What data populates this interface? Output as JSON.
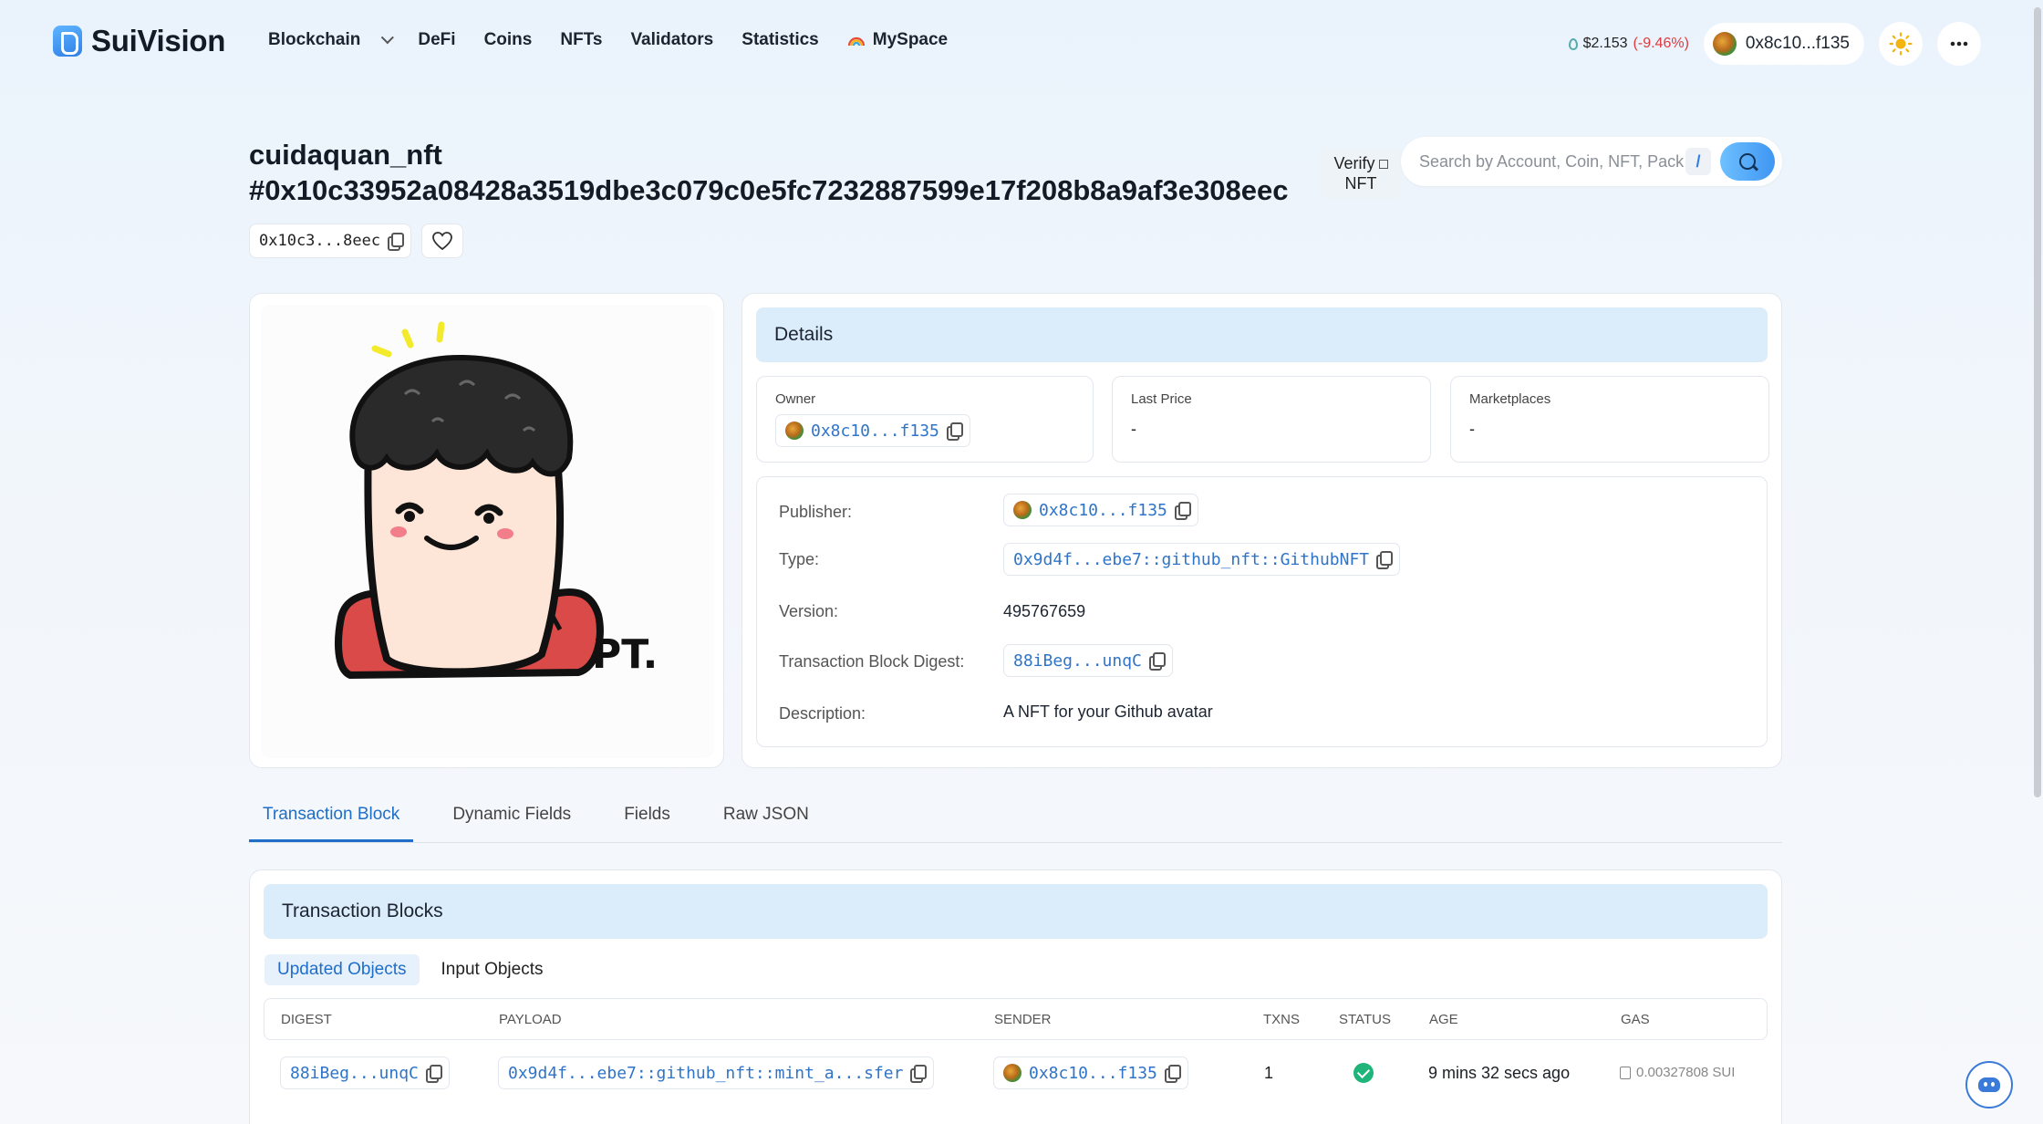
{
  "header": {
    "brand": "SuiVision",
    "nav": [
      {
        "label": "Blockchain"
      },
      {
        "label": "DeFi"
      },
      {
        "label": "Coins"
      },
      {
        "label": "NFTs"
      },
      {
        "label": "Validators"
      },
      {
        "label": "Statistics"
      },
      {
        "label": "MySpace"
      }
    ],
    "price": "$2.153",
    "price_change": "(-9.46%)",
    "wallet": "0x8c10...f135"
  },
  "nft": {
    "title_line1": "cuidaquan_nft",
    "title_line2": "#0x10c33952a08428a3519dbe3c079c0e5fc7232887599e17f208b8a9af3e308eec",
    "short_id": "0x10c3...8eec",
    "image_text": "PT."
  },
  "verify": {
    "line1": "Verify",
    "line2": "NFT"
  },
  "search": {
    "placeholder": "Search by Account, Coin, NFT, Package...",
    "shortcut": "/"
  },
  "details": {
    "heading": "Details",
    "owner_label": "Owner",
    "owner": "0x8c10...f135",
    "last_price_label": "Last Price",
    "last_price": "-",
    "marketplaces_label": "Marketplaces",
    "marketplaces": "-",
    "publisher_label": "Publisher:",
    "publisher": "0x8c10...f135",
    "type_label": "Type:",
    "type": "0x9d4f...ebe7::github_nft::GithubNFT",
    "version_label": "Version:",
    "version": "495767659",
    "digest_label": "Transaction Block Digest:",
    "digest": "88iBeg...unqC",
    "description_label": "Description:",
    "description": "A NFT for your Github avatar"
  },
  "tabs": [
    {
      "label": "Transaction Block",
      "active": true
    },
    {
      "label": "Dynamic Fields"
    },
    {
      "label": "Fields"
    },
    {
      "label": "Raw JSON"
    }
  ],
  "tx": {
    "heading": "Transaction Blocks",
    "subtabs": [
      {
        "label": "Updated Objects",
        "active": true
      },
      {
        "label": "Input Objects"
      }
    ],
    "columns": [
      "DIGEST",
      "PAYLOAD",
      "SENDER",
      "TXNS",
      "STATUS",
      "AGE",
      "GAS"
    ],
    "rows": [
      {
        "digest": "88iBeg...unqC",
        "payload": "0x9d4f...ebe7::github_nft::mint_a...sfer",
        "sender": "0x8c10...f135",
        "txns": "1",
        "age": "9 mins 32 secs ago",
        "gas": "0.00327808 SUI"
      }
    ]
  },
  "colors": {
    "accent": "#1f6ec8",
    "negative": "#e0393e",
    "success": "#1fb57a"
  }
}
